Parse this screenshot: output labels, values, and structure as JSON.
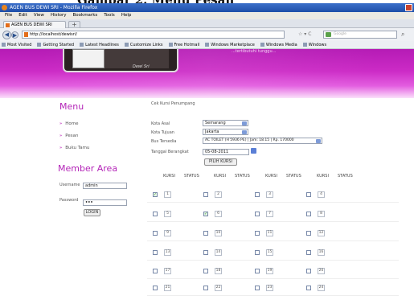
{
  "caption": "Gambar 2. Menu Pesan",
  "window": {
    "title": "AGEN BUS DEWI SRI - Mozilla Firefox"
  },
  "menubar": [
    "File",
    "Edit",
    "View",
    "History",
    "Bookmarks",
    "Tools",
    "Help"
  ],
  "tab": {
    "label": "AGEN BUS DEWI SRI",
    "new": "+"
  },
  "nav": {
    "url": "http://localhost/dewisri/"
  },
  "search": {
    "placeholder": "Google"
  },
  "bookmarks": [
    "Most Visited",
    "Getting Started",
    "Latest Headlines",
    "Customize Links",
    "Free Hotmail",
    "Windows Marketplace",
    "Windows Media",
    "Windows"
  ],
  "banner": {
    "photo_caption": "Dewi Sri",
    "text": "...tertibutuhi tunggu..."
  },
  "menu": {
    "title": "Menu",
    "items": [
      "Home",
      "Pesan",
      "Buku Tamu"
    ]
  },
  "member": {
    "title": "Member Area",
    "username_label": "Username",
    "username_value": "admin",
    "password_label": "Password",
    "password_value": "•••",
    "login": "LOGIN"
  },
  "form": {
    "heading": "Cek Kursi Penumpang",
    "kota_asal_label": "Kota Asal",
    "kota_asal": "Semarang",
    "kota_tujuan_label": "Kota Tujuan",
    "kota_tujuan": "Jakarta",
    "bus_label": "Bus Tersedia",
    "bus": "AC TOILET (H 5936 PE) | Jam: 18.15 | Rp. 170000",
    "tanggal_label": "Tanggal Berangkat",
    "tanggal": "05-08-2011",
    "pilih": "PILIH KURSI"
  },
  "seats": {
    "head_kursi": "KURSI",
    "head_status": "STATUS",
    "rows": [
      [
        {
          "n": "1",
          "c": true
        },
        {
          "n": "2",
          "c": false
        },
        {
          "n": "3",
          "c": false
        },
        {
          "n": "4",
          "c": false
        }
      ],
      [
        {
          "n": "5",
          "c": false
        },
        {
          "n": "6",
          "c": true
        },
        {
          "n": "7",
          "c": false
        },
        {
          "n": "8",
          "c": false
        }
      ],
      [
        {
          "n": "9",
          "c": false
        },
        {
          "n": "10",
          "c": false
        },
        {
          "n": "11",
          "c": false
        },
        {
          "n": "12",
          "c": false
        }
      ],
      [
        {
          "n": "13",
          "c": false
        },
        {
          "n": "14",
          "c": false
        },
        {
          "n": "15",
          "c": false
        },
        {
          "n": "16",
          "c": false
        }
      ],
      [
        {
          "n": "17",
          "c": false
        },
        {
          "n": "18",
          "c": false
        },
        {
          "n": "19",
          "c": false
        },
        {
          "n": "20",
          "c": false
        }
      ],
      [
        {
          "n": "21",
          "c": false
        },
        {
          "n": "22",
          "c": false
        },
        {
          "n": "23",
          "c": false
        },
        {
          "n": "24",
          "c": false
        }
      ]
    ]
  },
  "colors": {
    "accent": "#b425b8",
    "banner": "#cc2bc6",
    "check": "#3c9f3c"
  }
}
